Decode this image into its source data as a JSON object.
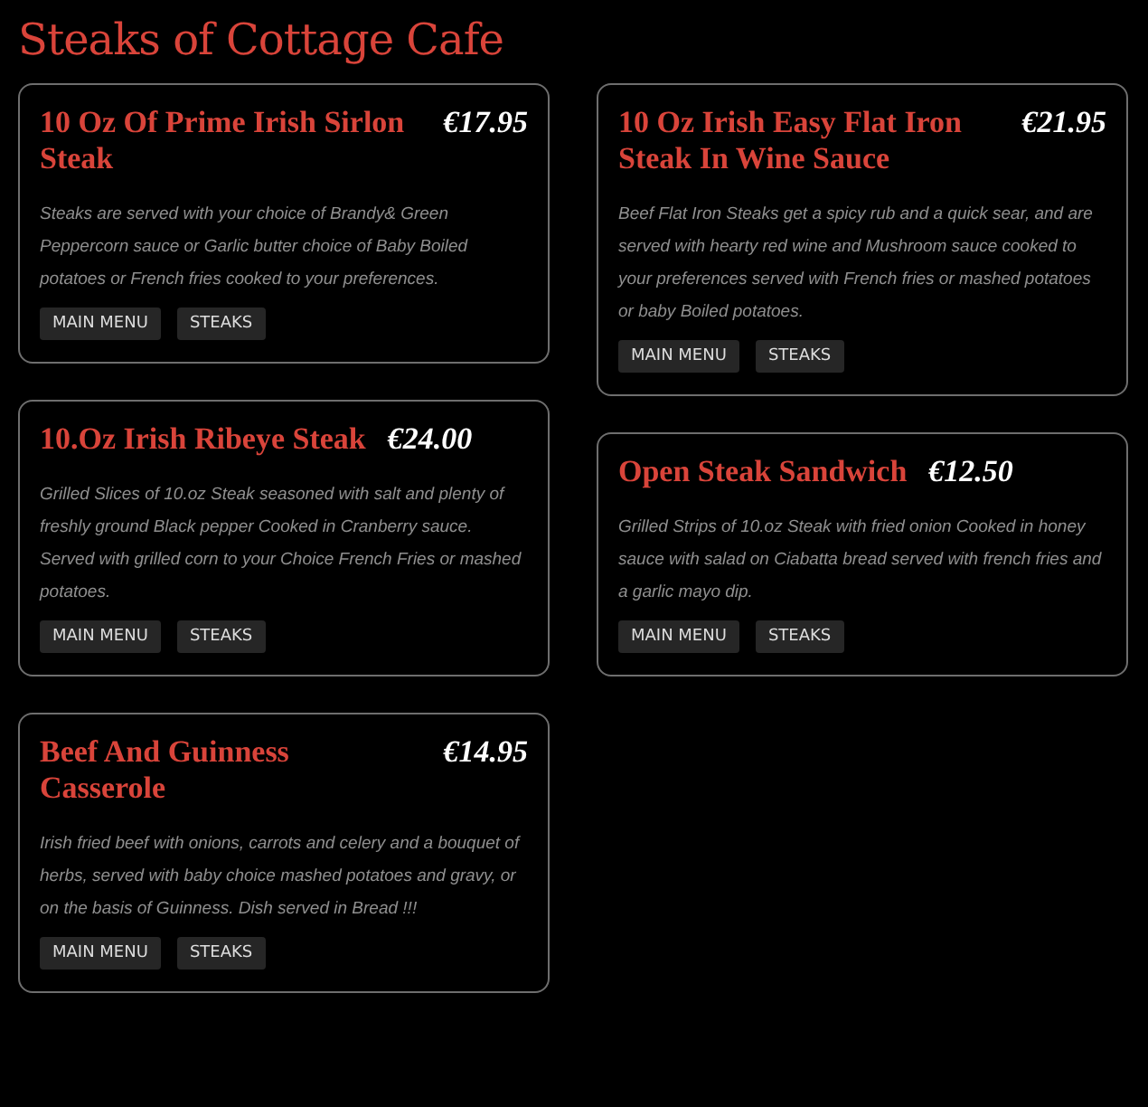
{
  "page_title": "Steaks of Cottage Cafe",
  "items": [
    {
      "name": "10 Oz Of Prime Irish Sirlon Steak",
      "price": "€17.95",
      "description": "Steaks are served with your choice of Brandy& Green Peppercorn sauce or Garlic butter choice of Baby Boiled potatoes or French fries cooked to your preferences.",
      "tags": [
        "MAIN MENU",
        "STEAKS"
      ]
    },
    {
      "name": "10 Oz Irish Easy Flat Iron Steak In Wine Sauce",
      "price": "€21.95",
      "description": "Beef Flat Iron Steaks get a spicy rub and a quick sear, and are served with hearty red wine and Mushroom sauce cooked to your preferences served with French fries or mashed potatoes or baby Boiled potatoes.",
      "tags": [
        "MAIN MENU",
        "STEAKS"
      ]
    },
    {
      "name": "10.Oz Irish Ribeye Steak",
      "price": "€24.00",
      "description": "Grilled Slices of 10.oz Steak seasoned with salt and plenty of freshly ground Black pepper Cooked in Cranberry sauce. Served with grilled corn to your Choice French Fries or mashed potatoes.",
      "tags": [
        "MAIN MENU",
        "STEAKS"
      ]
    },
    {
      "name": "Open Steak Sandwich",
      "price": "€12.50",
      "description": "Grilled Strips of 10.oz Steak with fried onion Cooked in honey sauce with salad on Ciabatta bread served with french fries and a garlic mayo dip.",
      "tags": [
        "MAIN MENU",
        "STEAKS"
      ]
    },
    {
      "name": "Beef And Guinness Casserole",
      "price": "€14.95",
      "description": "Irish fried beef with onions, carrots and celery and a bouquet of herbs, served with baby choice mashed potatoes and gravy, or on the basis of Guinness. Dish served in Bread !!!",
      "tags": [
        "MAIN MENU",
        "STEAKS"
      ]
    }
  ]
}
